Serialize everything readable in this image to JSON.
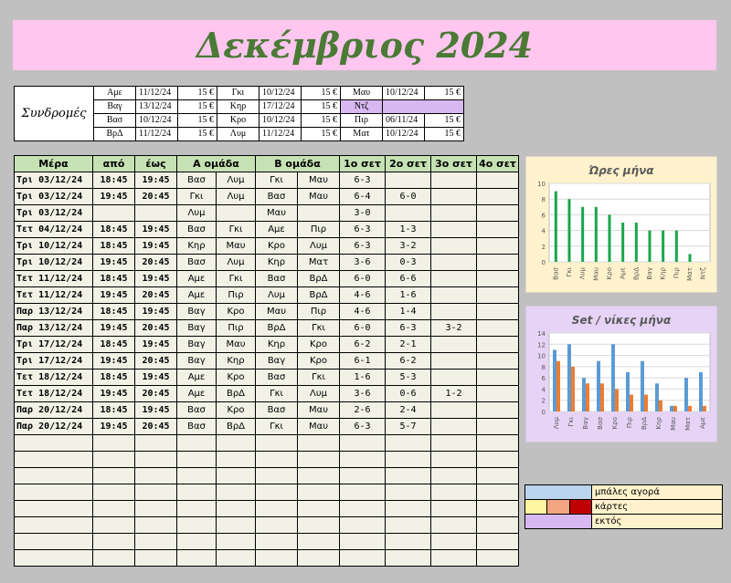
{
  "title": "Δεκέμβριος 2024",
  "subscriptions": {
    "label": "Συνδρομές",
    "rows": [
      [
        {
          "n": "Αμε",
          "d": "11/12/24",
          "p": "15 €"
        },
        {
          "n": "Γκι",
          "d": "10/12/24",
          "p": "15 €"
        },
        {
          "n": "Μαυ",
          "d": "10/12/24",
          "p": "15 €"
        }
      ],
      [
        {
          "n": "Βαγ",
          "d": "13/12/24",
          "p": "15 €"
        },
        {
          "n": "Κηρ",
          "d": "17/12/24",
          "p": "15 €"
        },
        {
          "n": "Ντζ",
          "d": "",
          "p": "",
          "lav": true
        }
      ],
      [
        {
          "n": "Βασ",
          "d": "10/12/24",
          "p": "15 €"
        },
        {
          "n": "Κρο",
          "d": "10/12/24",
          "p": "15 €"
        },
        {
          "n": "Πιρ",
          "d": "06/11/24",
          "p": "15 €"
        }
      ],
      [
        {
          "n": "ΒρΔ",
          "d": "11/12/24",
          "p": "15 €"
        },
        {
          "n": "Λυμ",
          "d": "11/12/24",
          "p": "15 €"
        },
        {
          "n": "Ματ",
          "d": "10/12/24",
          "p": "15 €"
        }
      ]
    ]
  },
  "schedule": {
    "headers": [
      "Μέρα",
      "από",
      "έως",
      "Α ομάδα",
      "Β ομάδα",
      "1ο σετ",
      "2ο σετ",
      "3ο σετ",
      "4ο σετ"
    ],
    "rows": [
      [
        "Τρι 03/12/24",
        "18:45",
        "19:45",
        "Βασ",
        "Λυμ",
        "Γκι",
        "Μαυ",
        "6-3",
        "",
        "",
        ""
      ],
      [
        "Τρι 03/12/24",
        "19:45",
        "20:45",
        "Γκι",
        "Λυμ",
        "Βασ",
        "Μαυ",
        "6-4",
        "6-0",
        "",
        ""
      ],
      [
        "Τρι 03/12/24",
        "",
        "",
        "Λυμ",
        "",
        "Μαυ",
        "",
        "3-0",
        "",
        "",
        ""
      ],
      [
        "Τετ 04/12/24",
        "18:45",
        "19:45",
        "Βασ",
        "Γκι",
        "Αμε",
        "Πιρ",
        "6-3",
        "1-3",
        "",
        ""
      ],
      [
        "Τρι 10/12/24",
        "18:45",
        "19:45",
        "Κηρ",
        "Μαυ",
        "Κρο",
        "Λυμ",
        "6-3",
        "3-2",
        "",
        ""
      ],
      [
        "Τρι 10/12/24",
        "19:45",
        "20:45",
        "Βασ",
        "Λυμ",
        "Κηρ",
        "Ματ",
        "3-6",
        "0-3",
        "",
        ""
      ],
      [
        "Τετ 11/12/24",
        "18:45",
        "19:45",
        "Αμε",
        "Γκι",
        "Βασ",
        "ΒρΔ",
        "6-0",
        "6-6",
        "",
        ""
      ],
      [
        "Τετ 11/12/24",
        "19:45",
        "20:45",
        "Αμε",
        "Πιρ",
        "Λυμ",
        "ΒρΔ",
        "4-6",
        "1-6",
        "",
        ""
      ],
      [
        "Παρ 13/12/24",
        "18:45",
        "19:45",
        "Βαγ",
        "Κρο",
        "Μαυ",
        "Πιρ",
        "4-6",
        "1-4",
        "",
        ""
      ],
      [
        "Παρ 13/12/24",
        "19:45",
        "20:45",
        "Βαγ",
        "Πιρ",
        "ΒρΔ",
        "Γκι",
        "6-0",
        "6-3",
        "3-2",
        ""
      ],
      [
        "Τρι 17/12/24",
        "18:45",
        "19:45",
        "Βαγ",
        "Μαυ",
        "Κηρ",
        "Κρο",
        "6-2",
        "2-1",
        "",
        ""
      ],
      [
        "Τρι 17/12/24",
        "19:45",
        "20:45",
        "Βαγ",
        "Κηρ",
        "Βαγ",
        "Κρο",
        "6-1",
        "6-2",
        "",
        ""
      ],
      [
        "Τετ 18/12/24",
        "18:45",
        "19:45",
        "Αμε",
        "Κρο",
        "Βασ",
        "Γκι",
        "1-6",
        "5-3",
        "",
        ""
      ],
      [
        "Τετ 18/12/24",
        "19:45",
        "20:45",
        "Αμε",
        "ΒρΔ",
        "Γκι",
        "Λυμ",
        "3-6",
        "0-6",
        "1-2",
        ""
      ],
      [
        "Παρ 20/12/24",
        "18:45",
        "19:45",
        "Βασ",
        "Κρο",
        "Βασ",
        "Μαυ",
        "2-6",
        "2-4",
        "",
        ""
      ],
      [
        "Παρ 20/12/24",
        "19:45",
        "20:45",
        "Βασ",
        "ΒρΔ",
        "Γκι",
        "Μαυ",
        "6-3",
        "5-7",
        "",
        ""
      ]
    ],
    "empty_rows": 8
  },
  "legend": [
    {
      "label": "μπάλες αγορά",
      "swatches": [
        "#b9d4ec"
      ]
    },
    {
      "label": "κάρτες",
      "swatches": [
        "#fff5a0",
        "#f4a582",
        "#c00000"
      ]
    },
    {
      "label": "εκτός",
      "swatches": [
        "#d8b8f0"
      ]
    }
  ],
  "chart_data": [
    {
      "type": "bar",
      "title": "Ώρες μήνα",
      "categories": [
        "Βασ",
        "Γκι",
        "Λυμ",
        "Μαυ",
        "Κρο",
        "Αμε",
        "ΒρΔ",
        "Βαγ",
        "Κηρ",
        "Πιρ",
        "Ματ",
        "Ντζ"
      ],
      "values": [
        9,
        8,
        7,
        7,
        6,
        5,
        5,
        4,
        4,
        4,
        1,
        0
      ],
      "ylim": [
        0,
        10
      ],
      "yticks": [
        0,
        2,
        4,
        6,
        8,
        10
      ],
      "color": "#1aa64a",
      "bg": "#fff2cc",
      "grid": true
    },
    {
      "type": "bar",
      "title": "Set / νίκες μήνα",
      "categories": [
        "Λυμ",
        "Γκι",
        "Βαγ",
        "Βασ",
        "Κρο",
        "Πιρ",
        "ΒρΔ",
        "Κηρ",
        "Μαυ",
        "Ματ",
        "Αμε"
      ],
      "series": [
        {
          "values": [
            11,
            12,
            6,
            9,
            12,
            7,
            9,
            5,
            1,
            6,
            7
          ],
          "color": "#5b9bd5"
        },
        {
          "values": [
            9,
            8,
            5,
            5,
            4,
            3,
            3,
            2,
            1,
            1,
            1
          ],
          "color": "#ed7d31"
        }
      ],
      "ylim": [
        0,
        14
      ],
      "yticks": [
        0,
        2,
        4,
        6,
        8,
        10,
        12,
        14
      ],
      "bg": "#e6d3f5",
      "grid": true
    }
  ]
}
